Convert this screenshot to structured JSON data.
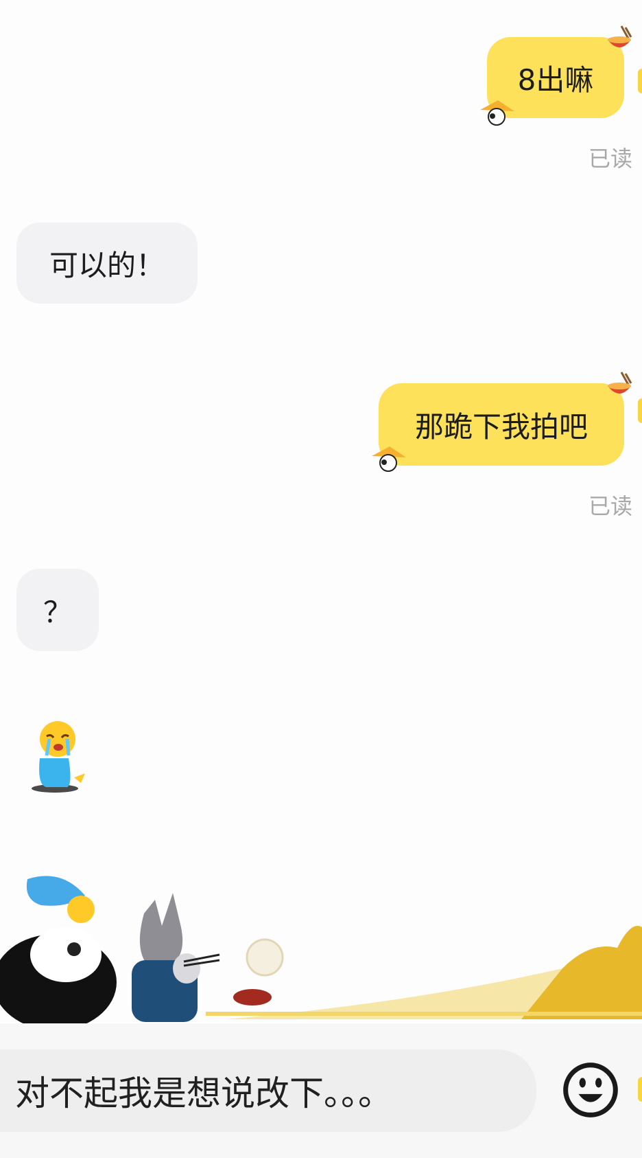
{
  "messages": [
    {
      "side": "sent",
      "text": "8出嘛",
      "read_status": "已读"
    },
    {
      "side": "received",
      "text": "可以的！"
    },
    {
      "side": "sent",
      "text": "那跪下我拍吧",
      "read_status": "已读"
    },
    {
      "side": "received",
      "text": "？"
    },
    {
      "side": "received",
      "type": "sticker",
      "sticker": "crying-kneeling-emoji-sticker"
    }
  ],
  "composer": {
    "draft_text": "对不起我是想说改下。。。",
    "emoji_icon": "smiley-face-icon"
  },
  "colors": {
    "sent_bubble": "#fde15a",
    "received_bubble": "#f2f2f4",
    "read_status": "#a8a8a8",
    "background": "#fdfdfd"
  }
}
